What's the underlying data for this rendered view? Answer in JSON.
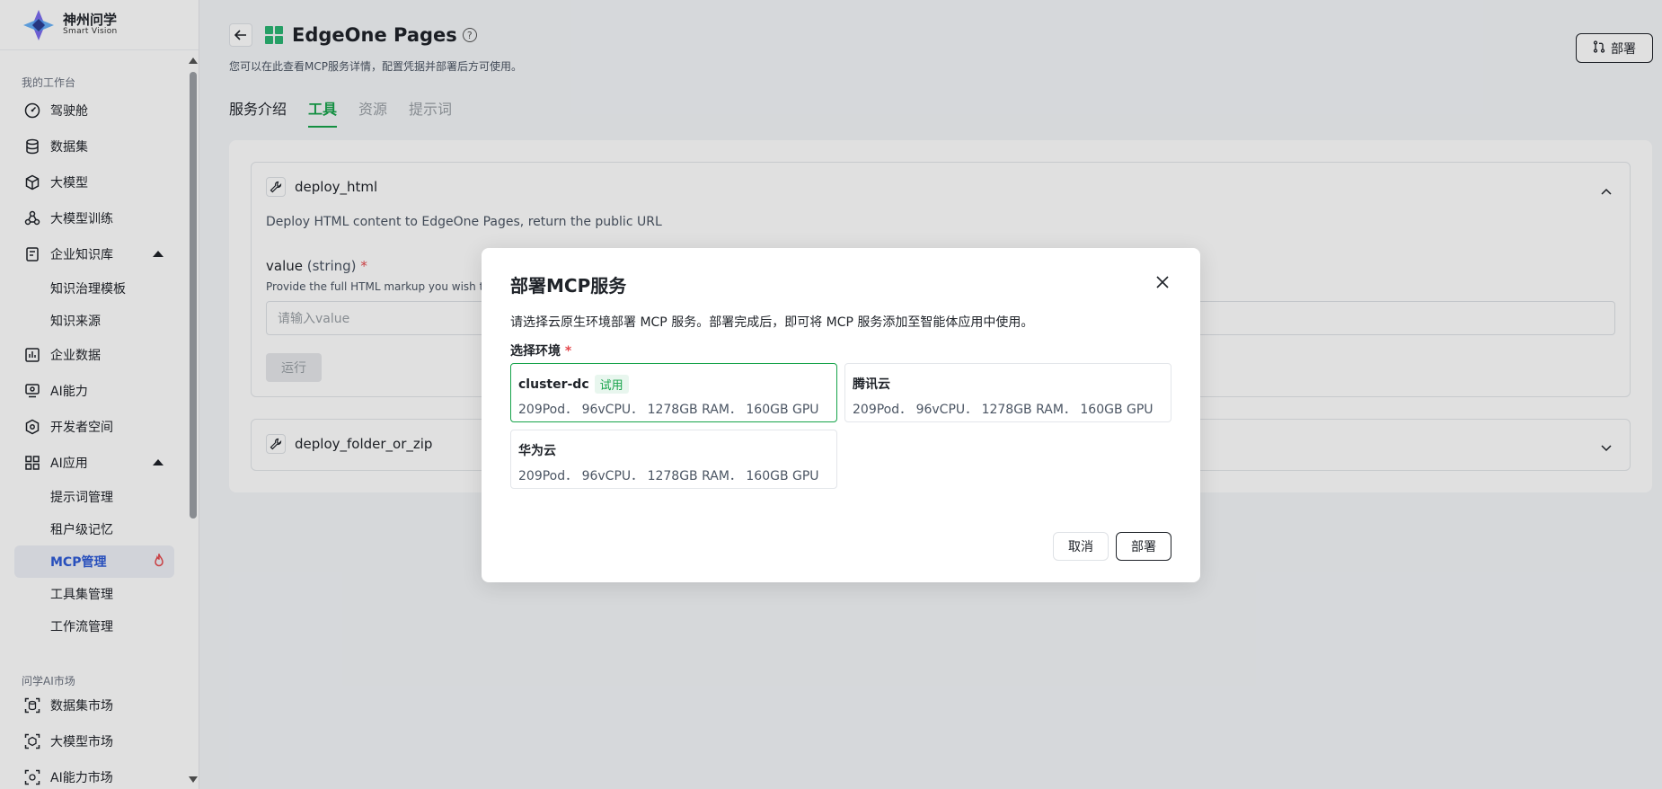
{
  "brand": {
    "name_cn": "神州问学",
    "name_en": "Smart Vision"
  },
  "sidebar": {
    "group1": "我的工作台",
    "items": [
      {
        "label": "驾驶舱",
        "icon": "dashboard-icon"
      },
      {
        "label": "数据集",
        "icon": "database-icon"
      },
      {
        "label": "大模型",
        "icon": "cube-icon"
      },
      {
        "label": "大模型训练",
        "icon": "training-icon"
      },
      {
        "label": "企业知识库",
        "icon": "knowledge-icon",
        "expanded": true
      },
      {
        "label": "知识治理模板",
        "sub": true
      },
      {
        "label": "知识来源",
        "sub": true
      },
      {
        "label": "企业数据",
        "icon": "chart-icon"
      },
      {
        "label": "AI能力",
        "icon": "monitor-icon"
      },
      {
        "label": "开发者空间",
        "icon": "developer-icon"
      },
      {
        "label": "AI应用",
        "icon": "apps-icon",
        "expanded": true
      },
      {
        "label": "提示词管理",
        "sub": true
      },
      {
        "label": "租户级记忆",
        "sub": true
      },
      {
        "label": "MCP管理",
        "sub": true,
        "active": true
      },
      {
        "label": "工具集管理",
        "sub": true
      },
      {
        "label": "工作流管理",
        "sub": true
      }
    ],
    "group2": "问学AI市场",
    "market": [
      {
        "label": "数据集市场",
        "icon": "dataset-market-icon"
      },
      {
        "label": "大模型市场",
        "icon": "model-market-icon"
      },
      {
        "label": "AI能力市场",
        "icon": "ai-market-icon"
      }
    ]
  },
  "page": {
    "title": "EdgeOne Pages",
    "subtitle": "您可以在此查看MCP服务详情，配置凭据并部署后方可使用。",
    "deploy_label": "部署",
    "tabs": [
      {
        "label": "服务介绍",
        "state": "normal"
      },
      {
        "label": "工具",
        "state": "active"
      },
      {
        "label": "资源",
        "state": "muted"
      },
      {
        "label": "提示词",
        "state": "muted"
      }
    ]
  },
  "tools": [
    {
      "name": "deploy_html",
      "description": "Deploy HTML content to EdgeOne Pages, return the public URL",
      "param_name": "value",
      "param_type": "(string)",
      "param_required": "*",
      "param_hint": "Provide the full HTML markup you wish to",
      "placeholder": "请输入value",
      "run_label": "运行"
    },
    {
      "name": "deploy_folder_or_zip"
    }
  ],
  "modal": {
    "title": "部署MCP服务",
    "description": "请选择云原生环境部署 MCP 服务。部署完成后，即可将 MCP 服务添加至智能体应用中使用。",
    "env_label": "选择环境",
    "env_required": "*",
    "environments": [
      {
        "name": "cluster-dc",
        "badge": "试用",
        "spec": "209Pod． 96vCPU． 1278GB RAM． 160GB GPU",
        "selected": true
      },
      {
        "name": "腾讯云",
        "spec": "209Pod． 96vCPU． 1278GB RAM． 160GB GPU"
      },
      {
        "name": "华为云",
        "spec": "209Pod． 96vCPU． 1278GB RAM． 160GB GPU"
      }
    ],
    "cancel_label": "取消",
    "confirm_label": "部署"
  },
  "colors": {
    "accent_green": "#16a34a",
    "active_blue": "#2e5bd7",
    "required_red": "#e5484d",
    "fire_red": "#e5484d"
  }
}
